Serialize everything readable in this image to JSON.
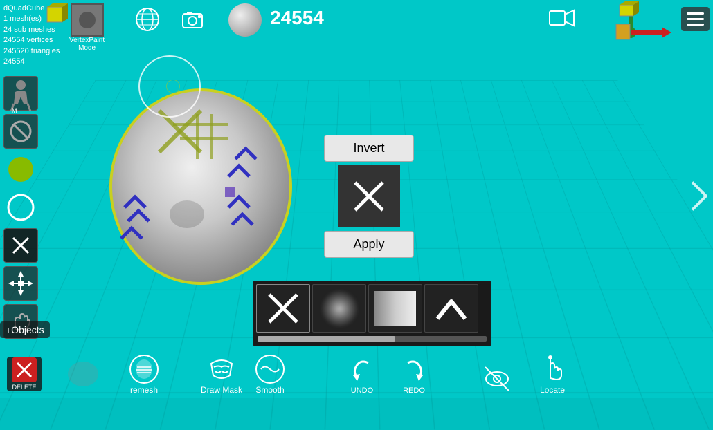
{
  "viewport": {
    "background_color": "#00c4c4"
  },
  "top_left": {
    "title": "dQuadCube",
    "mesh_count": "1 mesh(es)",
    "sub_meshes": "24 sub meshes",
    "vertices": "24554 vertices",
    "triangles": "245520 triangles",
    "id": "24554"
  },
  "vertex_count": "24554",
  "vertex_paint_label": "VertexPaint",
  "mode_label": "Mode",
  "invert_panel": {
    "invert_label": "Invert",
    "apply_label": "Apply"
  },
  "brush_panel": {
    "brushes": [
      {
        "id": "cross",
        "type": "cross"
      },
      {
        "id": "smoke",
        "type": "smoke"
      },
      {
        "id": "gradient",
        "type": "gradient"
      },
      {
        "id": "chevron",
        "type": "chevron"
      }
    ]
  },
  "bottom_bar": {
    "remesh_label": "remesh",
    "draw_mask_label": "Draw Mask",
    "smooth_label": "Smooth",
    "undo_label": "UNDO",
    "redo_label": "REDO",
    "hide_label": "",
    "locate_label": "Locate"
  },
  "add_objects_label": "+Objects",
  "delete_label": "DELETE",
  "icons": {
    "globe": "🌐",
    "camera_snapshot": "📷",
    "video_camera": "🎥",
    "hamburger": "☰",
    "right_arrow": "❯",
    "figure": "🧍",
    "no_entry": "⊘",
    "circle": "⬤",
    "ring": "○",
    "x_mark": "✕",
    "delete_x": "✕",
    "undo_arrow": "↩",
    "redo_arrow": "↪",
    "eye_slash": "👁",
    "crosshair": "✛",
    "mask_icon": "⬡",
    "wave": "〜"
  }
}
